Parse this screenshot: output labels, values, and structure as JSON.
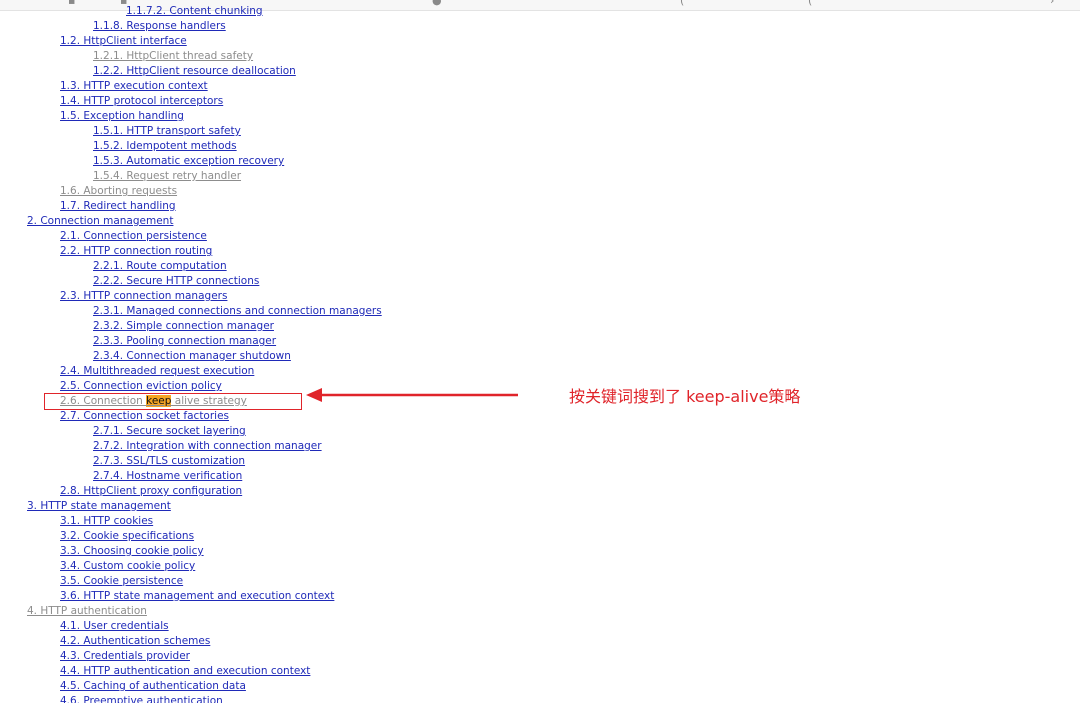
{
  "colors": {
    "link": "#1f2ab8",
    "visited": "#8d8d8d",
    "highlight": "#f6a623",
    "annotation": "#e0242a"
  },
  "toc": [
    {
      "text": "1.1.7.2. Content chunking",
      "level": 4,
      "state": "link"
    },
    {
      "text": "1.1.8. Response handlers",
      "level": 3,
      "state": "link"
    },
    {
      "text": "1.2. HttpClient interface",
      "level": 2,
      "state": "link"
    },
    {
      "text": "1.2.1. HttpClient thread safety",
      "level": 3,
      "state": "visited"
    },
    {
      "text": "1.2.2. HttpClient resource deallocation",
      "level": 3,
      "state": "link"
    },
    {
      "text": "1.3. HTTP execution context",
      "level": 2,
      "state": "link"
    },
    {
      "text": "1.4. HTTP protocol interceptors",
      "level": 2,
      "state": "link"
    },
    {
      "text": "1.5. Exception handling",
      "level": 2,
      "state": "link"
    },
    {
      "text": "1.5.1. HTTP transport safety",
      "level": 3,
      "state": "link"
    },
    {
      "text": "1.5.2. Idempotent methods",
      "level": 3,
      "state": "link"
    },
    {
      "text": "1.5.3. Automatic exception recovery",
      "level": 3,
      "state": "link"
    },
    {
      "text": "1.5.4. Request retry handler",
      "level": 3,
      "state": "visited"
    },
    {
      "text": "1.6. Aborting requests",
      "level": 2,
      "state": "visited"
    },
    {
      "text": "1.7. Redirect handling",
      "level": 2,
      "state": "link"
    },
    {
      "text": "2. Connection management",
      "level": 1,
      "state": "link"
    },
    {
      "text": "2.1. Connection persistence",
      "level": 2,
      "state": "link"
    },
    {
      "text": "2.2. HTTP connection routing",
      "level": 2,
      "state": "link"
    },
    {
      "text": "2.2.1. Route computation",
      "level": 3,
      "state": "link"
    },
    {
      "text": "2.2.2. Secure HTTP connections",
      "level": 3,
      "state": "link"
    },
    {
      "text": "2.3. HTTP connection managers",
      "level": 2,
      "state": "link"
    },
    {
      "text": "2.3.1. Managed connections and connection managers",
      "level": 3,
      "state": "link"
    },
    {
      "text": "2.3.2. Simple connection manager",
      "level": 3,
      "state": "link"
    },
    {
      "text": "2.3.3. Pooling connection manager",
      "level": 3,
      "state": "link"
    },
    {
      "text": "2.3.4. Connection manager shutdown",
      "level": 3,
      "state": "link"
    },
    {
      "text": "2.4. Multithreaded request execution",
      "level": 2,
      "state": "link"
    },
    {
      "text": "2.5. Connection eviction policy",
      "level": 2,
      "state": "link"
    },
    {
      "text": "2.6. Connection keep alive strategy",
      "level": 2,
      "state": "visited",
      "pre": "2.6. Connection ",
      "hl": "keep",
      "post": " alive strategy"
    },
    {
      "text": "2.7. Connection socket factories",
      "level": 2,
      "state": "link"
    },
    {
      "text": "2.7.1. Secure socket layering",
      "level": 3,
      "state": "link"
    },
    {
      "text": "2.7.2. Integration with connection manager",
      "level": 3,
      "state": "link"
    },
    {
      "text": "2.7.3. SSL/TLS customization",
      "level": 3,
      "state": "link"
    },
    {
      "text": "2.7.4. Hostname verification",
      "level": 3,
      "state": "link"
    },
    {
      "text": "2.8. HttpClient proxy configuration",
      "level": 2,
      "state": "link"
    },
    {
      "text": "3. HTTP state management",
      "level": 1,
      "state": "link"
    },
    {
      "text": "3.1. HTTP cookies",
      "level": 2,
      "state": "link"
    },
    {
      "text": "3.2. Cookie specifications",
      "level": 2,
      "state": "link"
    },
    {
      "text": "3.3. Choosing cookie policy",
      "level": 2,
      "state": "link"
    },
    {
      "text": "3.4. Custom cookie policy",
      "level": 2,
      "state": "link"
    },
    {
      "text": "3.5. Cookie persistence",
      "level": 2,
      "state": "link"
    },
    {
      "text": "3.6. HTTP state management and execution context",
      "level": 2,
      "state": "link"
    },
    {
      "text": "4. HTTP authentication",
      "level": 1,
      "state": "visited"
    },
    {
      "text": "4.1. User credentials",
      "level": 2,
      "state": "link"
    },
    {
      "text": "4.2. Authentication schemes",
      "level": 2,
      "state": "link"
    },
    {
      "text": "4.3. Credentials provider",
      "level": 2,
      "state": "link"
    },
    {
      "text": "4.4. HTTP authentication and execution context",
      "level": 2,
      "state": "link"
    },
    {
      "text": "4.5. Caching of authentication data",
      "level": 2,
      "state": "link"
    },
    {
      "text": "4.6. Preemptive authentication",
      "level": 2,
      "state": "link"
    }
  ],
  "annotation": {
    "text": "按关键词搜到了 keep-alive策略"
  }
}
